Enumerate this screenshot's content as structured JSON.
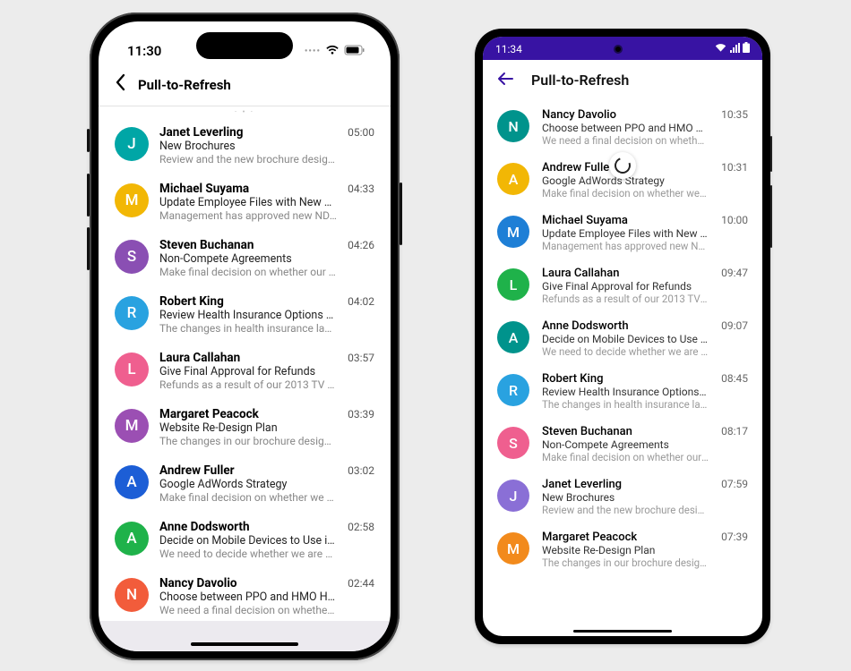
{
  "ios": {
    "statusbar_time": "11:30",
    "header_title": "Pull-to-Refresh",
    "items": [
      {
        "initial": "J",
        "color": "#00a6a6",
        "name": "Janet Leverling",
        "subject": "New Brochures",
        "preview": "Review and the new brochure designs...",
        "time": "05:00"
      },
      {
        "initial": "M",
        "color": "#f2b705",
        "name": "Michael Suyama",
        "subject": "Update Employee Files with New NDA",
        "preview": "Management has approved new NDA....",
        "time": "04:33"
      },
      {
        "initial": "S",
        "color": "#8a4fb3",
        "name": "Steven Buchanan",
        "subject": "Non-Compete Agreements",
        "preview": "Make final decision on whether our e...",
        "time": "04:26"
      },
      {
        "initial": "R",
        "color": "#29a2e0",
        "name": "Robert King",
        "subject": "Review Health Insurance Options Und...",
        "preview": "The changes in health insurance laws...",
        "time": "04:02"
      },
      {
        "initial": "L",
        "color": "#ef5f8f",
        "name": "Laura Callahan",
        "subject": "Give Final Approval for Refunds",
        "preview": "Refunds as a result of our 2013 TV rec...",
        "time": "03:57"
      },
      {
        "initial": "M",
        "color": "#9b4fb3",
        "name": "Margaret Peacock",
        "subject": "Website Re-Design Plan",
        "preview": "The changes in our brochure designs...",
        "time": "03:39"
      },
      {
        "initial": "A",
        "color": "#1c5ed6",
        "name": "Andrew Fuller",
        "subject": "Google AdWords Strategy",
        "preview": "Make final decision on whether we are...",
        "time": "03:02"
      },
      {
        "initial": "A",
        "color": "#1fb24a",
        "name": "Anne Dodsworth",
        "subject": "Decide on Mobile Devices to Use in th...",
        "preview": "We need to decide whether we are goi...",
        "time": "02:58"
      },
      {
        "initial": "N",
        "color": "#f25c3b",
        "name": "Nancy Davolio",
        "subject": "Choose between PPO and HMO Healt...",
        "preview": "We need a final decision on whether w...",
        "time": "02:44"
      }
    ]
  },
  "android": {
    "statusbar_time": "11:34",
    "header_title": "Pull-to-Refresh",
    "items": [
      {
        "initial": "N",
        "color": "#00938c",
        "name": "Nancy Davolio",
        "subject": "Choose between PPO and HMO Health ...",
        "preview": "We need a final decision on whether we ...",
        "time": "10:35"
      },
      {
        "initial": "A",
        "color": "#f2b705",
        "name": "Andrew Fuller",
        "subject": "Google AdWords Strategy",
        "preview": "Make final decision on whether we are g...",
        "time": "10:31"
      },
      {
        "initial": "M",
        "color": "#1e7fd6",
        "name": "Michael Suyama",
        "subject": "Update Employee Files with New NDA",
        "preview": "Management has approved new NDA. Al...",
        "time": "10:00"
      },
      {
        "initial": "L",
        "color": "#1fb24a",
        "name": "Laura Callahan",
        "subject": "Give Final Approval for Refunds",
        "preview": "Refunds as a result of our 2013 TV recal...",
        "time": "09:47"
      },
      {
        "initial": "A",
        "color": "#00938c",
        "name": "Anne Dodsworth",
        "subject": "Decide on Mobile Devices to Use in the F...",
        "preview": "We need to decide whether we are going...",
        "time": "09:07"
      },
      {
        "initial": "R",
        "color": "#29a2e0",
        "name": "Robert King",
        "subject": "Review Health Insurance Options Under ...",
        "preview": "The changes in health insurance laws re...",
        "time": "08:45"
      },
      {
        "initial": "S",
        "color": "#ef5f8f",
        "name": "Steven Buchanan",
        "subject": "Non-Compete Agreements",
        "preview": "Make final decision on whether our empl...",
        "time": "08:17"
      },
      {
        "initial": "J",
        "color": "#8a6fd6",
        "name": "Janet Leverling",
        "subject": "New Brochures",
        "preview": "Review and the new brochure designs an...",
        "time": "07:59"
      },
      {
        "initial": "M",
        "color": "#f28a1c",
        "name": "Margaret Peacock",
        "subject": "Website Re-Design Plan",
        "preview": "The changes in our brochure designs for...",
        "time": "07:39"
      }
    ]
  }
}
